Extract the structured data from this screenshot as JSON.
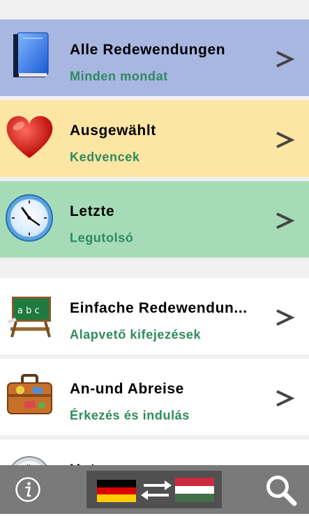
{
  "categories": [
    {
      "title": "Alle Redewendungen",
      "subtitle": "Minden mondat",
      "icon": "book-icon",
      "bg": "#a8b6e2"
    },
    {
      "title": "Ausgewählt",
      "subtitle": "Kedvencek",
      "icon": "heart-icon",
      "bg": "#fde5a3"
    },
    {
      "title": "Letzte",
      "subtitle": "Legutolsó",
      "icon": "clock-icon",
      "bg": "#a5dcb7"
    },
    {
      "title": "Einfache Redewendun...",
      "subtitle": "Alapvető kifejezések",
      "icon": "chalkboard-icon",
      "bg": "#ffffff"
    },
    {
      "title": "An-und Abreise",
      "subtitle": "Érkezés és indulás",
      "icon": "suitcase-icon",
      "bg": "#ffffff"
    },
    {
      "title": "Unterwegs",
      "subtitle": "",
      "icon": "compass-icon",
      "bg": "#ffffff"
    }
  ],
  "chevron_glyph": ">",
  "bottom_bar": {
    "info_icon": "info-icon",
    "language_switch": {
      "from": "german-flag-icon",
      "to": "hungarian-flag-icon",
      "swap": "swap-arrows-icon"
    },
    "search_icon": "search-icon"
  }
}
